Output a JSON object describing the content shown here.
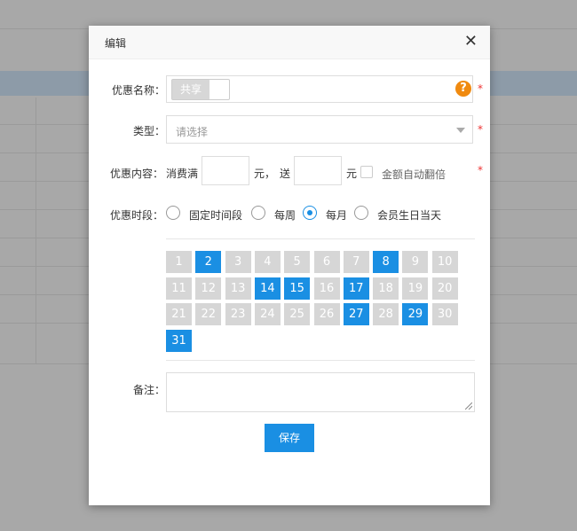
{
  "dialog": {
    "title": "编辑",
    "close_glyph": "✕"
  },
  "form": {
    "name_label": "优惠名称：",
    "share_toggle_label": "共享",
    "help_glyph": "?",
    "required_mark": "*",
    "type_label": "类型：",
    "type_placeholder": "请选择",
    "content_label": "优惠内容：",
    "content_prefix": "消费满",
    "content_unit1": "元，",
    "content_send": "送",
    "content_unit2": "元",
    "auto_double_label": "金额自动翻倍",
    "period_label": "优惠时段：",
    "period_options": [
      "固定时间段",
      "每周",
      "每月",
      "会员生日当天"
    ],
    "period_selected": "每月",
    "note_label": "备注："
  },
  "calendar": {
    "days": [
      "1",
      "2",
      "3",
      "4",
      "5",
      "6",
      "7",
      "8",
      "9",
      "10",
      "11",
      "12",
      "13",
      "14",
      "15",
      "16",
      "17",
      "18",
      "19",
      "20",
      "21",
      "22",
      "23",
      "24",
      "25",
      "26",
      "27",
      "28",
      "29",
      "30",
      "31"
    ],
    "selected": [
      "2",
      "8",
      "14",
      "15",
      "17",
      "27",
      "29",
      "31"
    ]
  },
  "actions": {
    "save_label": "保存"
  },
  "colors": {
    "accent": "#1a8fe3",
    "day_unselected": "#d6d6d6",
    "help_icon": "#f08a10",
    "required": "#e33333"
  }
}
